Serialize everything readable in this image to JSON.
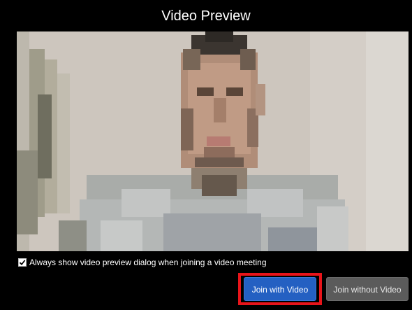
{
  "dialog": {
    "title": "Video Preview",
    "checkbox": {
      "label": "Always show video preview dialog when joining a video meeting",
      "checked": true
    },
    "buttons": {
      "join_with_video": "Join with Video",
      "join_without_video": "Join without Video"
    },
    "preview_icon": "camera-feed-pixelated"
  },
  "colors": {
    "primary_button": "#2460c2",
    "secondary_button": "#5b5b5b",
    "highlight": "#e8141a",
    "background": "#000000"
  }
}
